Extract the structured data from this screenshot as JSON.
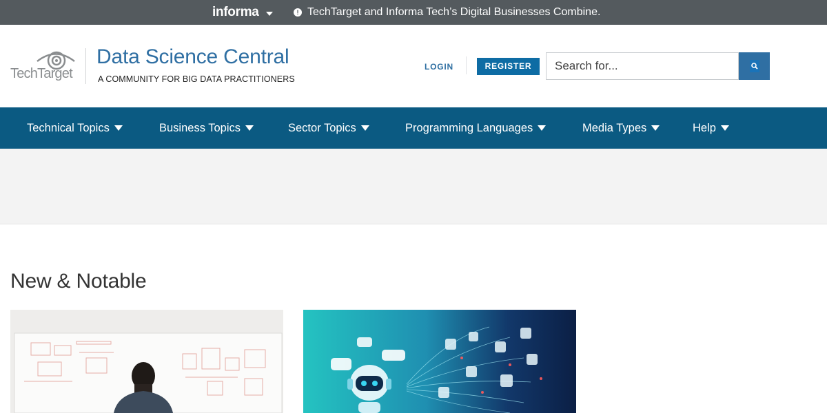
{
  "topbar": {
    "brand": "informa",
    "notice": "TechTarget and Informa Tech’s Digital Businesses Combine."
  },
  "header": {
    "logo_text": "TechTarget",
    "site_title": "Data Science Central",
    "tagline": "A COMMUNITY FOR BIG DATA PRACTITIONERS",
    "login_label": "LOGIN",
    "register_label": "REGISTER",
    "search_placeholder": "Search for..."
  },
  "nav": {
    "items": [
      {
        "label": "Technical Topics"
      },
      {
        "label": "Business Topics"
      },
      {
        "label": "Sector Topics"
      },
      {
        "label": "Programming Languages"
      },
      {
        "label": "Media Types"
      },
      {
        "label": "Help"
      }
    ]
  },
  "main": {
    "section_title": "New & Notable"
  },
  "colors": {
    "topbar_bg": "#545a5e",
    "nav_bg": "#0b5a82",
    "brand_blue": "#2f6fa3",
    "register_bg": "#0e6ca4"
  },
  "icons": {
    "search": "search-icon",
    "dropdown": "caret-down-icon",
    "info": "info-icon",
    "logo": "eye-logo-icon"
  }
}
